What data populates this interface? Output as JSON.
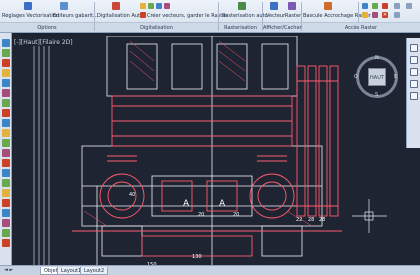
{
  "ribbon": {
    "buttons": {
      "reglages": "Réglages Vectorisation",
      "editeurs": "Editeurs gabarit...",
      "digit_auto": "Digitalisation Auto",
      "creer_vecteurs": "Créer vecteurs, garder le Raster",
      "rast_auto": "Rasterisation auto",
      "vecteur": "Vecteur",
      "raster": "Raster",
      "bascule": "Bascule Accrochage Raster"
    },
    "panels": {
      "options": "Options",
      "digitalisation": "Digitalisation",
      "rasterisation": "Rasterisation auto",
      "afficher": "Afficher/Cacher",
      "acces": "Accès Raster"
    }
  },
  "viewport": {
    "label": "[-][Haut][Filaire 2D]"
  },
  "viewcube": {
    "face": "HAUT",
    "north": "N",
    "south": "S",
    "east": "E",
    "west": "O"
  },
  "drawing": {
    "labels": [
      "A",
      "A",
      "130",
      "150",
      "40",
      "22",
      "28",
      "28",
      "20",
      "20"
    ]
  },
  "tabs": {
    "nav": "◄ ►",
    "items": [
      "Objet",
      "Layout1",
      "Layout2"
    ]
  }
}
